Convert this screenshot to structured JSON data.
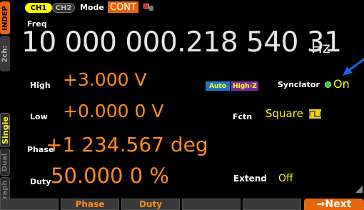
{
  "side_tabs": {
    "indep": "INDEP",
    "two_ch": "2ch:",
    "single": "Single",
    "dual": "Dual",
    "graph": "Graph"
  },
  "top_bar": {
    "ch1": "CH1",
    "ch2": "CH2",
    "mode_label": "Mode",
    "mode_value": "CONT"
  },
  "freq": {
    "label": "Freq",
    "value": "10 000 000.218 540 31",
    "unit": "Hz"
  },
  "params": {
    "high": {
      "label": "High",
      "value": "+3.000 V"
    },
    "low": {
      "label": "Low",
      "value": "+0.000 0 V"
    },
    "phase": {
      "label": "Phase",
      "value": "+1 234.567 deg"
    },
    "duty": {
      "label": "Duty",
      "value": "50.000 0 %"
    }
  },
  "badges": {
    "auto": "Auto",
    "high_z": "High-Z"
  },
  "synclator": {
    "label": "Synclator",
    "value": "On"
  },
  "fctn": {
    "label": "Fctn",
    "value": "Square"
  },
  "extend": {
    "label": "Extend",
    "value": "Off"
  },
  "softkeys": [
    "",
    "Phase",
    "Duty",
    "",
    "",
    "⇒Next"
  ],
  "colors": {
    "accent_orange": "#e8650e",
    "value_orange": "#ff8c1a",
    "highlight_yellow": "#ffff00",
    "arrow_blue": "#2060e0",
    "badge_blue": "#1e78c8",
    "badge_purple": "#7a2fa0"
  }
}
